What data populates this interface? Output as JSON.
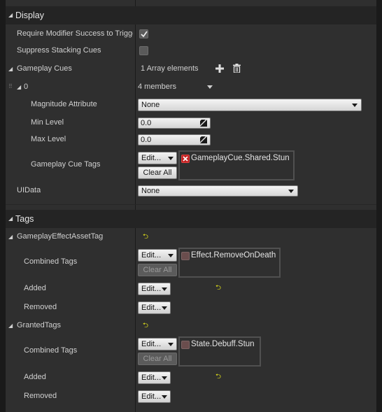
{
  "display": {
    "title": "Display",
    "require_label": "Require Modifier Success to Trigger Cues",
    "suppress_label": "Suppress Stacking Cues",
    "gameplay_cues": {
      "label": "Gameplay Cues",
      "count_text": "1 Array elements"
    },
    "element": {
      "label": "0",
      "members_text": "4 members"
    },
    "magnitude": {
      "label": "Magnitude Attribute",
      "value": "None"
    },
    "min_level": {
      "label": "Min Level",
      "value": "0.0"
    },
    "max_level": {
      "label": "Max Level",
      "value": "0.0"
    },
    "cue_tags": {
      "label": "Gameplay Cue Tags",
      "edit": "Edit...",
      "clear": "Clear All",
      "tag": "GameplayCue.Shared.Stun"
    },
    "uidata": {
      "label": "UIData",
      "value": "None"
    }
  },
  "tags": {
    "title": "Tags",
    "asset_tag": {
      "label": "GameplayEffectAssetTag",
      "combined_label": "Combined Tags",
      "edit": "Edit...",
      "clear": "Clear All",
      "tag": "Effect.RemoveOnDeath",
      "added_label": "Added",
      "added_edit": "Edit...",
      "removed_label": "Removed",
      "removed_edit": "Edit..."
    },
    "granted": {
      "label": "GrantedTags",
      "combined_label": "Combined Tags",
      "edit": "Edit...",
      "clear": "Clear All",
      "tag": "State.Debuff.Stun",
      "added_label": "Added",
      "added_edit": "Edit...",
      "removed_label": "Removed",
      "removed_edit": "Edit..."
    }
  },
  "glyphs": {
    "reset": "⮌",
    "expanded": "◢",
    "grip": "⠿",
    "plus": "✚"
  },
  "icons": [
    "expand-arrow-icon",
    "checkmark-icon",
    "add-element-icon",
    "delete-trash-icon",
    "reset-to-default-icon",
    "clear-tag-icon",
    "drag-handle-icon",
    "value-slider-icon"
  ],
  "colors": {
    "panel": "#2f2f2f",
    "header": "#242424",
    "reset_arrow": "#e5e518",
    "tag_remove": "#c42020"
  }
}
